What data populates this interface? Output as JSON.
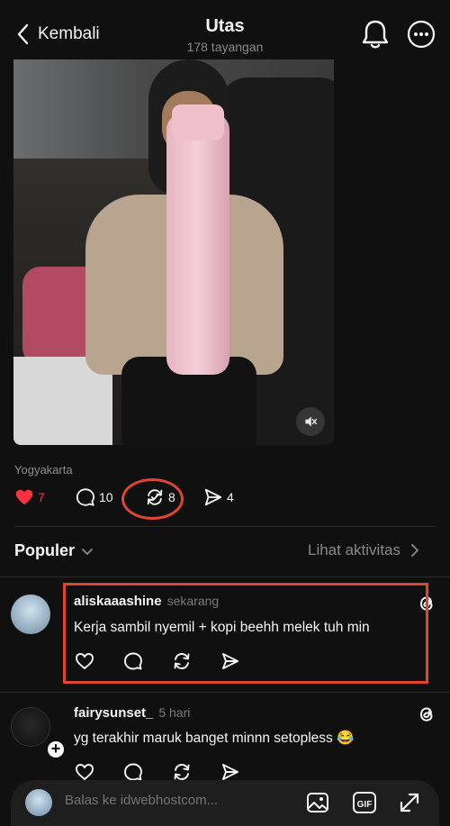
{
  "header": {
    "back_label": "Kembali",
    "title": "Utas",
    "subtitle": "178 tayangan"
  },
  "post": {
    "location": "Yogyakarta",
    "likes": "7",
    "comments": "10",
    "reposts": "8",
    "shares": "4"
  },
  "sort": {
    "label": "Populer",
    "activity_label": "Lihat aktivitas"
  },
  "replies": [
    {
      "username": "aliskaaashine",
      "time": "sekarang",
      "text": "Kerja sambil nyemil + kopi beehh melek tuh min"
    },
    {
      "username": "fairysunset_",
      "time": "5 hari",
      "text": "yg terakhir maruk banget minnn setopless 😂"
    }
  ],
  "reply_bar": {
    "placeholder": "Balas ke idwebhostcom..."
  },
  "colors": {
    "background": "#101010",
    "like_red": "#ff3040",
    "annotation": "#e1452f"
  }
}
